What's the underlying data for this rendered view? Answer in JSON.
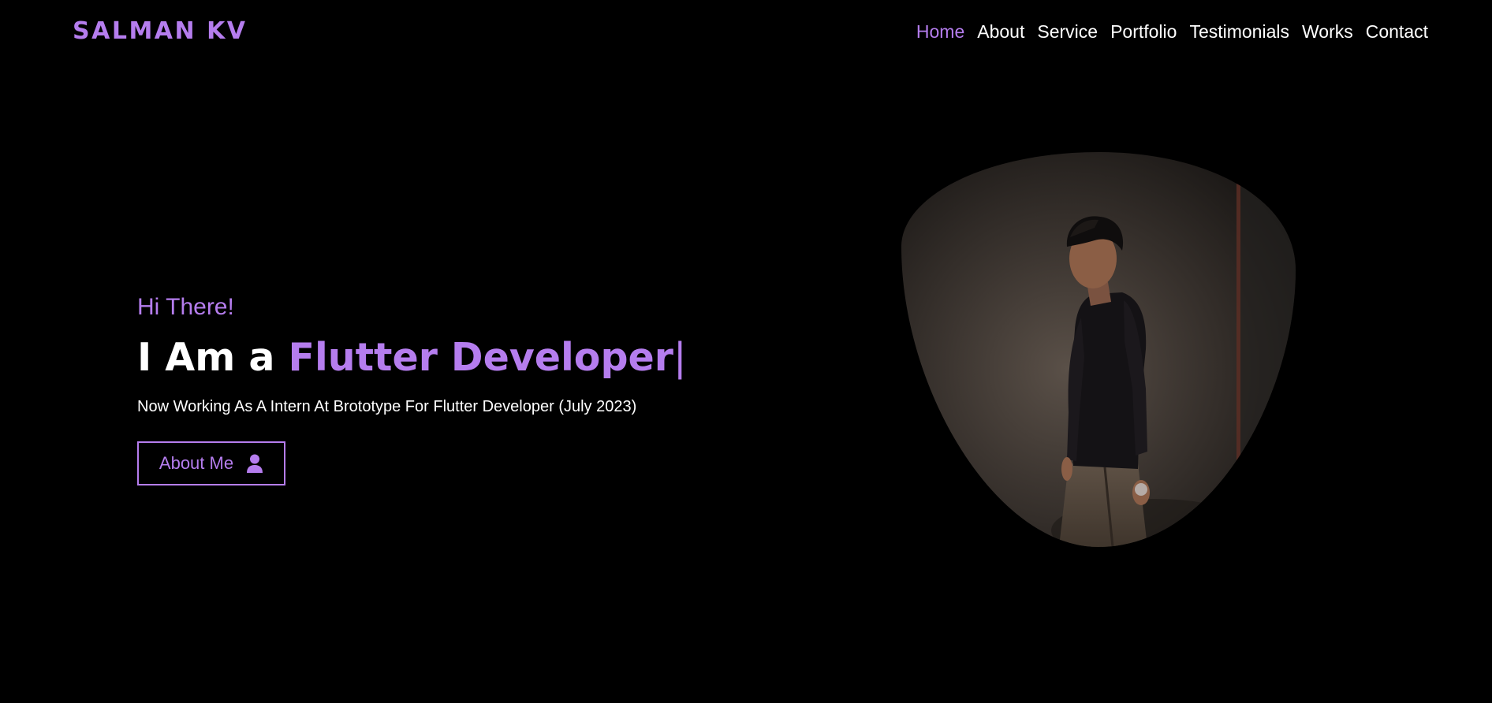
{
  "header": {
    "brand": "SALMAN KV",
    "nav": [
      {
        "label": "Home",
        "active": true
      },
      {
        "label": "About",
        "active": false
      },
      {
        "label": "Service",
        "active": false
      },
      {
        "label": "Portfolio",
        "active": false
      },
      {
        "label": "Testimonials",
        "active": false
      },
      {
        "label": "Works",
        "active": false
      },
      {
        "label": "Contact",
        "active": false
      }
    ]
  },
  "hero": {
    "greeting": "Hi There!",
    "headline_prefix": "I Am a ",
    "headline_accent": "Flutter Developer",
    "cursor": "|",
    "subtitle": "Now Working As A Intern At Brototype For Flutter Developer (July 2023)",
    "button_label": "About Me",
    "button_icon": "user-icon"
  },
  "colors": {
    "accent": "#b57dee",
    "background": "#000000",
    "text": "#ffffff"
  }
}
